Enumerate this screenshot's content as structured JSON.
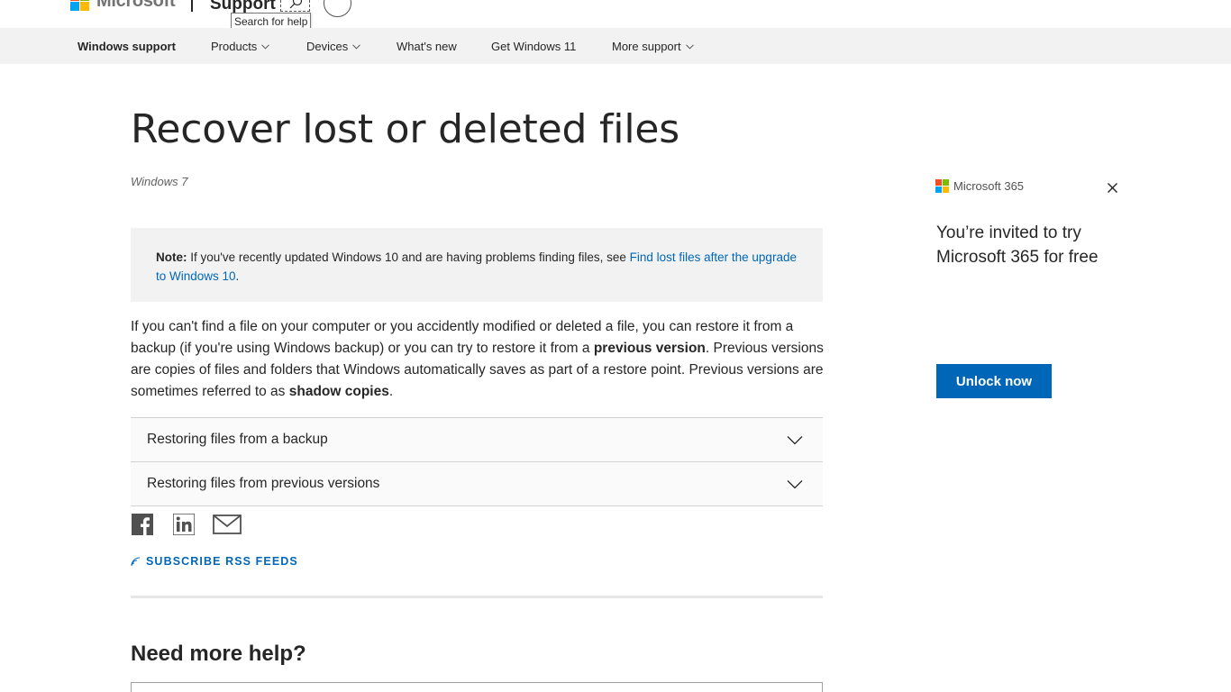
{
  "header": {
    "brand": "Microsoft",
    "support_label": "Support",
    "search_tooltip": "Search for help",
    "logo_colors": [
      "#f25022",
      "#7fba00",
      "#00a4ef",
      "#ffb900"
    ]
  },
  "nav": {
    "items": [
      {
        "label": "Windows support",
        "active": true
      },
      {
        "label": "Products",
        "dropdown": true
      },
      {
        "label": "Devices",
        "dropdown": true
      },
      {
        "label": "What's new"
      },
      {
        "label": "Get Windows 11"
      },
      {
        "label": "More support",
        "dropdown": true
      }
    ]
  },
  "article": {
    "title": "Recover lost or deleted files",
    "applies_to": "Windows 7",
    "note": {
      "label": "Note:",
      "text": " If you've recently updated Windows 10 and are having problems finding files, see ",
      "link": "Find lost files after the upgrade to Windows 10",
      "end": "."
    },
    "paragraph": {
      "part1": "If you can't find a file on your computer or you accidently modified or deleted a file, you can restore it from a backup (if you're using Windows backup) or you can try to restore it from a ",
      "bold1": "previous version",
      "part2": ". Previous versions are copies of files and folders that Windows automatically saves as part of a restore point. Previous versions are sometimes referred to as ",
      "bold2": "shadow copies",
      "part3": "."
    },
    "accordions": [
      {
        "label": "Restoring files from a backup"
      },
      {
        "label": "Restoring files from previous versions"
      }
    ],
    "share_icons": [
      "facebook-icon",
      "linkedin-icon",
      "email-icon"
    ],
    "rss_label": "SUBSCRIBE RSS FEEDS",
    "more_help": "Need more help?"
  },
  "promo": {
    "brand": "Microsoft 365",
    "text": "You’re invited to try Microsoft 365 for free",
    "button": "Unlock now"
  },
  "colors": {
    "accent": "#0067b8",
    "nav_bg": "#f2f2f2",
    "text": "#262626"
  }
}
